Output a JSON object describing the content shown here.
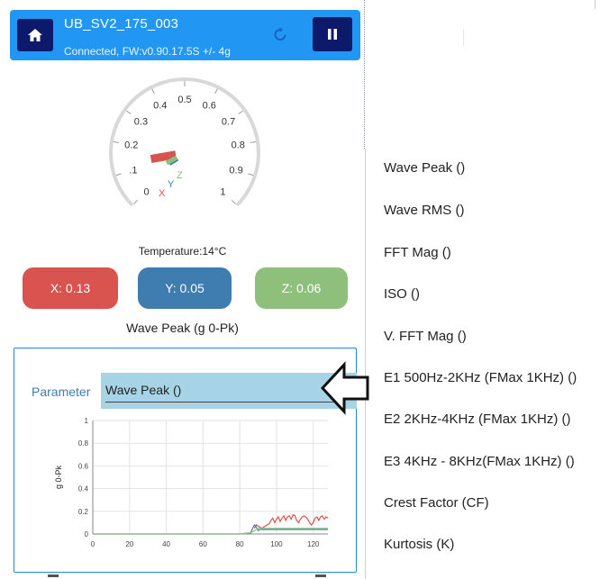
{
  "app": {
    "device_name": "UB_SV2_175_003",
    "status": "Connected, FW:v0.90.17.5S +/- 4g",
    "temperature": "Temperature:14°C",
    "icons": {
      "home": "home-icon",
      "refresh": "refresh-icon",
      "pause": "pause-icon"
    }
  },
  "gauge": {
    "ticks": [
      "0",
      ".1",
      "0.2",
      "0.3",
      "0.4",
      "0.5",
      "0.6",
      "0.7",
      "0.8",
      "0.9",
      "1"
    ],
    "value_x": 0.13,
    "value_y": 0.05,
    "value_z": 0.06,
    "axis_labels": {
      "x": "X",
      "y": "Y",
      "z": "Z"
    },
    "colors": {
      "x": "#d9534f",
      "y": "#3f7cb0",
      "z": "#8ec07c"
    }
  },
  "readings": {
    "x": "X: 0.13",
    "y": "Y: 0.05",
    "z": "Z: 0.06"
  },
  "wave_title": "Wave Peak (g 0-Pk)",
  "parameter": {
    "label": "Parameter",
    "value": "Wave Peak ()"
  },
  "chart_data": {
    "type": "line",
    "ylabel": "g 0-Pk",
    "xlabel": "",
    "xlim": [
      0,
      128
    ],
    "ylim": [
      0,
      1
    ],
    "x_ticks": [
      "0",
      "20",
      "40",
      "60",
      "80",
      "100",
      "120"
    ],
    "y_ticks": [
      "0",
      "0.2",
      "0.4",
      "0.6",
      "0.8",
      "1"
    ],
    "series": [
      {
        "color": "#d9534f",
        "x": [
          88,
          89,
          90,
          91,
          92,
          93,
          94,
          95,
          96,
          97,
          98,
          99,
          100,
          101,
          102,
          103,
          104,
          105,
          106,
          107,
          108,
          109,
          110,
          111,
          112,
          113,
          114,
          115,
          116,
          117,
          118,
          119,
          120,
          121,
          122,
          123,
          124,
          125,
          126,
          127,
          128
        ],
        "values": [
          0.05,
          0.08,
          0.07,
          0.06,
          0.05,
          0.06,
          0.07,
          0.08,
          0.09,
          0.12,
          0.14,
          0.1,
          0.13,
          0.15,
          0.11,
          0.14,
          0.16,
          0.12,
          0.15,
          0.16,
          0.13,
          0.17,
          0.16,
          0.12,
          0.1,
          0.13,
          0.15,
          0.16,
          0.15,
          0.13,
          0.1,
          0.08,
          0.1,
          0.14,
          0.15,
          0.12,
          0.15,
          0.16,
          0.13,
          0.15,
          0.14
        ]
      },
      {
        "color": "#3f7cb0",
        "x": [
          0,
          10,
          20,
          30,
          40,
          50,
          60,
          70,
          80,
          86,
          87,
          88,
          89,
          90,
          91,
          92,
          100,
          110,
          120,
          128
        ],
        "values": [
          0.0,
          0.0,
          0.0,
          0.0,
          0.0,
          0.0,
          0.0,
          0.0,
          0.0,
          0.01,
          0.05,
          0.08,
          0.06,
          0.03,
          0.04,
          0.04,
          0.04,
          0.04,
          0.04,
          0.04
        ]
      },
      {
        "color": "#8ec07c",
        "x": [
          0,
          10,
          20,
          30,
          40,
          50,
          60,
          70,
          80,
          86,
          88,
          90,
          92,
          100,
          110,
          120,
          128
        ],
        "values": [
          0.0,
          0.0,
          0.0,
          0.0,
          0.0,
          0.0,
          0.0,
          0.0,
          0.0,
          0.01,
          0.03,
          0.05,
          0.05,
          0.05,
          0.05,
          0.05,
          0.05
        ]
      }
    ]
  },
  "menu": {
    "items": [
      "Wave Peak ()",
      "Wave RMS ()",
      "FFT Mag ()",
      "ISO ()",
      "V. FFT Mag ()",
      "E1 500Hz-2KHz (FMax 1KHz) ()",
      "E2 2KHz-4KHz (FMax 1KHz) ()",
      "E3 4KHz - 8KHz(FMax 1KHz) ()",
      "Crest Factor (CF)",
      "Kurtosis (K)"
    ]
  },
  "annotation": {
    "arrow_icon": "left-arrow-icon"
  }
}
